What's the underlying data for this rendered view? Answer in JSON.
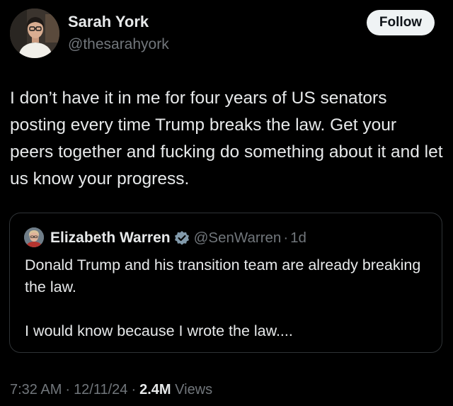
{
  "author": {
    "name": "Sarah York",
    "handle": "@thesarahyork"
  },
  "follow_label": "Follow",
  "tweet": {
    "text": "I don’t have it in me for four years of US senators posting every time Trump breaks the law. Get your peers together and fucking do something about it and let us know your progress."
  },
  "quote": {
    "name": "Elizabeth Warren",
    "handle": "@SenWarren",
    "separator": "·",
    "time": "1d",
    "text": "Donald Trump and his transition team are already breaking the law.\n\nI would know because I wrote the law...."
  },
  "meta": {
    "time": "7:32 AM",
    "date": "12/11/24",
    "separator": "·",
    "views_count": "2.4M",
    "views_label": "Views"
  },
  "colors": {
    "background": "#000000",
    "text_primary": "#e7e9ea",
    "text_secondary": "#71767b",
    "follow_bg": "#eff3f4",
    "border": "#2f3336",
    "verified_badge": "#829aab"
  }
}
